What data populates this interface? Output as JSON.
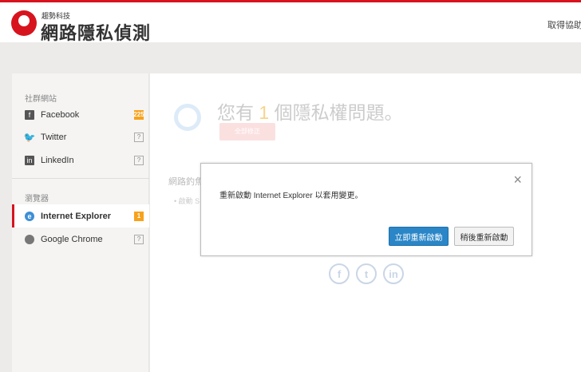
{
  "header": {
    "brand_small": "趨勢科技",
    "brand": "網路隱私偵測",
    "help": "取得協助"
  },
  "sidebar": {
    "social_title": "社群網站",
    "browser_title": "瀏覽器",
    "items": [
      {
        "label": "Facebook",
        "badge": "225"
      },
      {
        "label": "Twitter",
        "badge": "?"
      },
      {
        "label": "LinkedIn",
        "badge": "?"
      },
      {
        "label": "Internet Explorer",
        "badge": "1"
      },
      {
        "label": "Google Chrome",
        "badge": "?"
      }
    ]
  },
  "main": {
    "headline_pre": "您有 ",
    "count": "1",
    "headline_post": " 個隱私權問題。",
    "fix_all": "全部修正",
    "section": "網路釣魚",
    "bullet": "• 啟動 S"
  },
  "dialog": {
    "message": "重新啟動 Internet Explorer 以套用變更。",
    "restart_now": "立即重新啟動",
    "restart_later": "稍後重新啟動",
    "close": "×"
  },
  "colors": {
    "brand": "#d7141e",
    "primary": "#2a86c7",
    "warning": "#f7a21b"
  }
}
